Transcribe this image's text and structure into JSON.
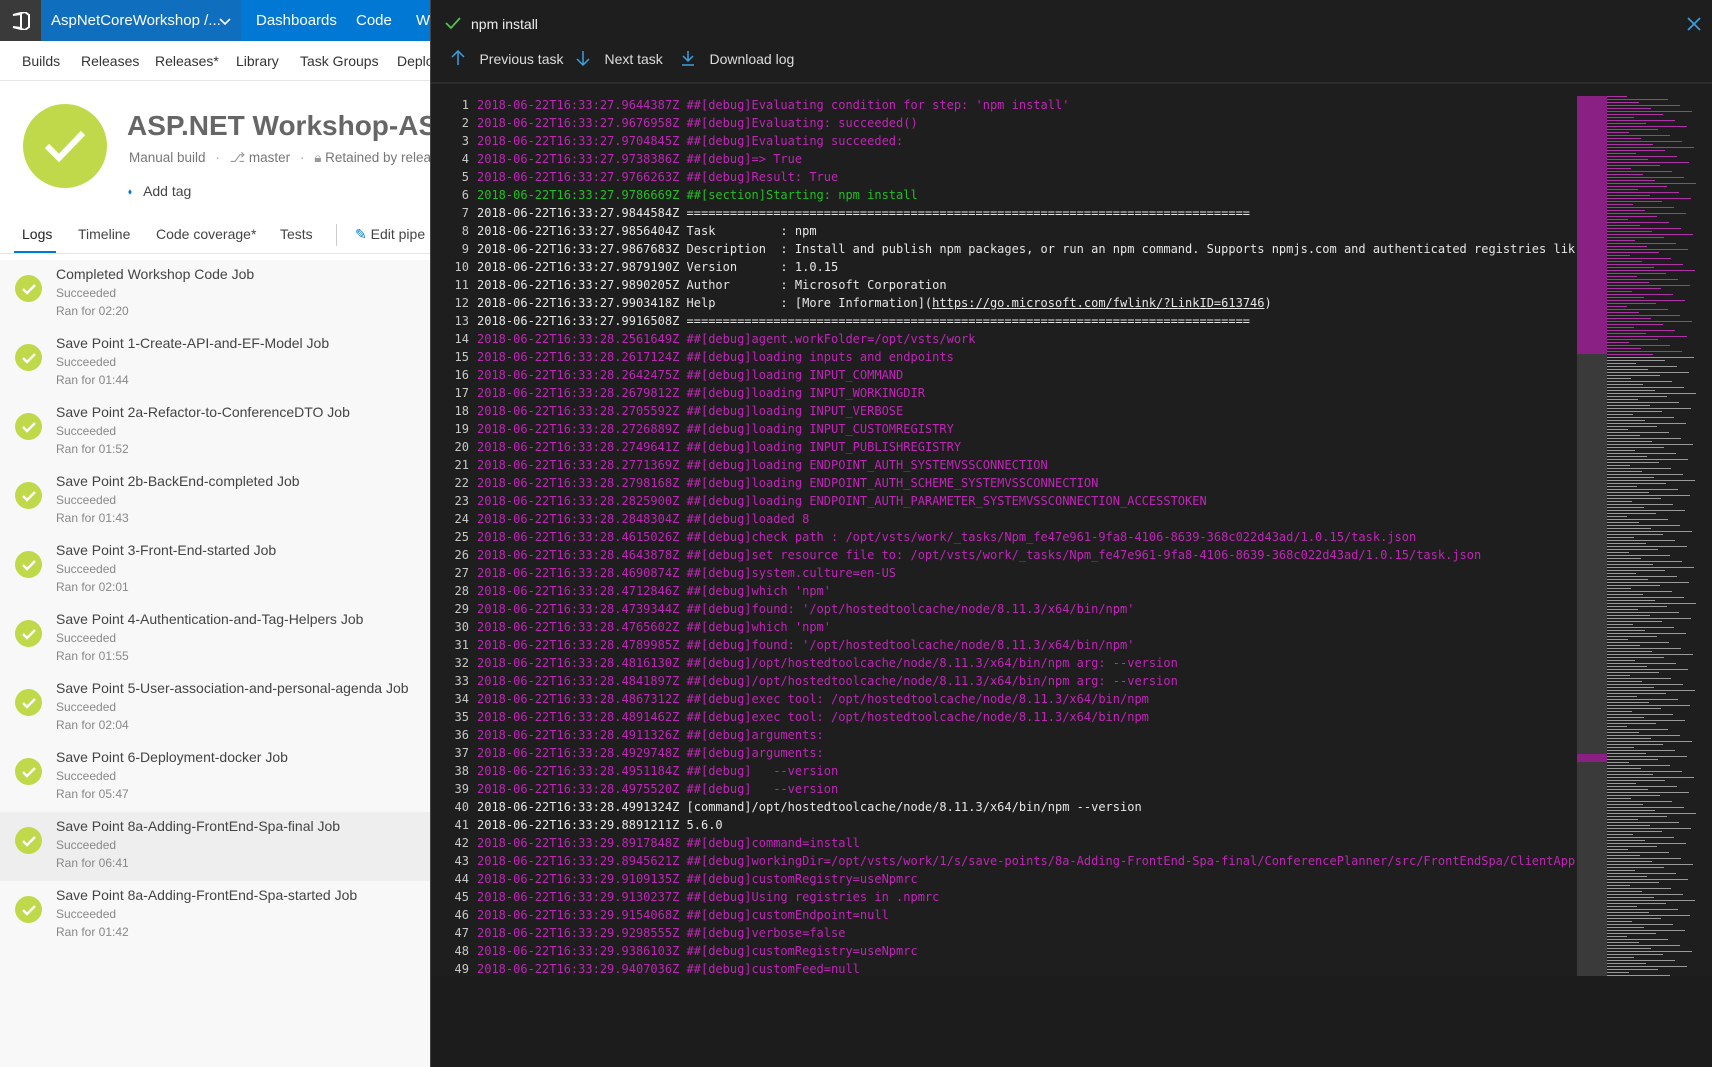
{
  "topbar": {
    "project": "AspNetCoreWorkshop /...",
    "nav": [
      "Dashboards",
      "Code",
      "W"
    ]
  },
  "subnav": [
    "Builds",
    "Releases",
    "Releases*",
    "Library",
    "Task Groups",
    "Deplo"
  ],
  "build": {
    "title": "ASP.NET Workshop-ASP",
    "trigger": "Manual build",
    "branch": "master",
    "retained": "Retained by relea",
    "add_tag": "Add tag"
  },
  "tabs": [
    "Logs",
    "Timeline",
    "Code coverage*",
    "Tests",
    "Edit pipe"
  ],
  "jobs": [
    {
      "name": "Completed Workshop Code Job",
      "status": "Succeeded",
      "duration": "Ran for 02:20"
    },
    {
      "name": "Save Point 1-Create-API-and-EF-Model Job",
      "status": "Succeeded",
      "duration": "Ran for 01:44"
    },
    {
      "name": "Save Point 2a-Refactor-to-ConferenceDTO Job",
      "status": "Succeeded",
      "duration": "Ran for 01:52"
    },
    {
      "name": "Save Point 2b-BackEnd-completed Job",
      "status": "Succeeded",
      "duration": "Ran for 01:43"
    },
    {
      "name": "Save Point 3-Front-End-started Job",
      "status": "Succeeded",
      "duration": "Ran for 02:01"
    },
    {
      "name": "Save Point 4-Authentication-and-Tag-Helpers Job",
      "status": "Succeeded",
      "duration": "Ran for 01:55"
    },
    {
      "name": "Save Point 5-User-association-and-personal-agenda Job",
      "status": "Succeeded",
      "duration": "Ran for 02:04"
    },
    {
      "name": "Save Point 6-Deployment-docker Job",
      "status": "Succeeded",
      "duration": "Ran for 05:47"
    },
    {
      "name": "Save Point 8a-Adding-FrontEnd-Spa-final Job",
      "status": "Succeeded",
      "duration": "Ran for 06:41"
    },
    {
      "name": "Save Point 8a-Adding-FrontEnd-Spa-started Job",
      "status": "Succeeded",
      "duration": "Ran for 01:42"
    }
  ],
  "panel": {
    "task_title": "npm install",
    "toolbar": {
      "previous": "Previous task",
      "next": "Next task",
      "download": "Download log"
    }
  },
  "colors": {
    "success": "#bfd94b",
    "accent": "#0078d4",
    "debug": "#c024b8",
    "section": "#20c020"
  },
  "log": [
    {
      "n": "1",
      "kind": "debug",
      "text": "2018-06-22T16:33:27.9644387Z ##[debug]Evaluating condition for step: 'npm install'"
    },
    {
      "n": "2",
      "kind": "debug",
      "text": "2018-06-22T16:33:27.9676958Z ##[debug]Evaluating: succeeded()"
    },
    {
      "n": "3",
      "kind": "debug",
      "text": "2018-06-22T16:33:27.9704845Z ##[debug]Evaluating succeeded:"
    },
    {
      "n": "4",
      "kind": "debug",
      "text": "2018-06-22T16:33:27.9738386Z ##[debug]=> True"
    },
    {
      "n": "5",
      "kind": "debug",
      "text": "2018-06-22T16:33:27.9766263Z ##[debug]Result: True"
    },
    {
      "n": "6",
      "kind": "section",
      "text": "2018-06-22T16:33:27.9786669Z ##[section]Starting: npm install"
    },
    {
      "n": "7",
      "kind": "plain",
      "text": "2018-06-22T16:33:27.9844584Z =============================================================================="
    },
    {
      "n": "8",
      "kind": "plain",
      "text": "2018-06-22T16:33:27.9856404Z Task         : npm"
    },
    {
      "n": "9",
      "kind": "plain",
      "text": "2018-06-22T16:33:27.9867683Z Description  : Install and publish npm packages, or run an npm command. Supports npmjs.com and authenticated registries lik"
    },
    {
      "n": "10",
      "kind": "plain",
      "text": "2018-06-22T16:33:27.9879190Z Version      : 1.0.15"
    },
    {
      "n": "11",
      "kind": "plain",
      "text": "2018-06-22T16:33:27.9890205Z Author       : Microsoft Corporation"
    },
    {
      "n": "12",
      "kind": "plain",
      "text": "2018-06-22T16:33:27.9903418Z Help         : [More Information](",
      "link": "https://go.microsoft.com/fwlink/?LinkID=613746",
      "after": ")"
    },
    {
      "n": "13",
      "kind": "plain",
      "text": "2018-06-22T16:33:27.9916508Z =============================================================================="
    },
    {
      "n": "14",
      "kind": "debug",
      "text": "2018-06-22T16:33:28.2561649Z ##[debug]agent.workFolder=/opt/vsts/work"
    },
    {
      "n": "15",
      "kind": "debug",
      "text": "2018-06-22T16:33:28.2617124Z ##[debug]loading inputs and endpoints"
    },
    {
      "n": "16",
      "kind": "debug",
      "text": "2018-06-22T16:33:28.2642475Z ##[debug]loading INPUT_COMMAND"
    },
    {
      "n": "17",
      "kind": "debug",
      "text": "2018-06-22T16:33:28.2679812Z ##[debug]loading INPUT_WORKINGDIR"
    },
    {
      "n": "18",
      "kind": "debug",
      "text": "2018-06-22T16:33:28.2705592Z ##[debug]loading INPUT_VERBOSE"
    },
    {
      "n": "19",
      "kind": "debug",
      "text": "2018-06-22T16:33:28.2726889Z ##[debug]loading INPUT_CUSTOMREGISTRY"
    },
    {
      "n": "20",
      "kind": "debug",
      "text": "2018-06-22T16:33:28.2749641Z ##[debug]loading INPUT_PUBLISHREGISTRY"
    },
    {
      "n": "21",
      "kind": "debug",
      "text": "2018-06-22T16:33:28.2771369Z ##[debug]loading ENDPOINT_AUTH_SYSTEMVSSCONNECTION"
    },
    {
      "n": "22",
      "kind": "debug",
      "text": "2018-06-22T16:33:28.2798168Z ##[debug]loading ENDPOINT_AUTH_SCHEME_SYSTEMVSSCONNECTION"
    },
    {
      "n": "23",
      "kind": "debug",
      "text": "2018-06-22T16:33:28.2825900Z ##[debug]loading ENDPOINT_AUTH_PARAMETER_SYSTEMVSSCONNECTION_ACCESSTOKEN"
    },
    {
      "n": "24",
      "kind": "debug",
      "text": "2018-06-22T16:33:28.2848304Z ##[debug]loaded 8"
    },
    {
      "n": "25",
      "kind": "debug",
      "text": "2018-06-22T16:33:28.4615026Z ##[debug]check path : /opt/vsts/work/_tasks/Npm_fe47e961-9fa8-4106-8639-368c022d43ad/1.0.15/task.json"
    },
    {
      "n": "26",
      "kind": "debug",
      "text": "2018-06-22T16:33:28.4643878Z ##[debug]set resource file to: /opt/vsts/work/_tasks/Npm_fe47e961-9fa8-4106-8639-368c022d43ad/1.0.15/task.json"
    },
    {
      "n": "27",
      "kind": "debug",
      "text": "2018-06-22T16:33:28.4690874Z ##[debug]system.culture=en-US"
    },
    {
      "n": "28",
      "kind": "debug",
      "text": "2018-06-22T16:33:28.4712846Z ##[debug]which 'npm'"
    },
    {
      "n": "29",
      "kind": "debug",
      "text": "2018-06-22T16:33:28.4739344Z ##[debug]found: '/opt/hostedtoolcache/node/8.11.3/x64/bin/npm'"
    },
    {
      "n": "30",
      "kind": "debug",
      "text": "2018-06-22T16:33:28.4765602Z ##[debug]which 'npm'"
    },
    {
      "n": "31",
      "kind": "debug",
      "text": "2018-06-22T16:33:28.4789985Z ##[debug]found: '/opt/hostedtoolcache/node/8.11.3/x64/bin/npm'"
    },
    {
      "n": "32",
      "kind": "debug",
      "text": "2018-06-22T16:33:28.4816130Z ##[debug]/opt/hostedtoolcache/node/8.11.3/x64/bin/npm arg: --version"
    },
    {
      "n": "33",
      "kind": "debug",
      "text": "2018-06-22T16:33:28.4841897Z ##[debug]/opt/hostedtoolcache/node/8.11.3/x64/bin/npm arg: --version"
    },
    {
      "n": "34",
      "kind": "debug",
      "text": "2018-06-22T16:33:28.4867312Z ##[debug]exec tool: /opt/hostedtoolcache/node/8.11.3/x64/bin/npm"
    },
    {
      "n": "35",
      "kind": "debug",
      "text": "2018-06-22T16:33:28.4891462Z ##[debug]exec tool: /opt/hostedtoolcache/node/8.11.3/x64/bin/npm"
    },
    {
      "n": "36",
      "kind": "debug",
      "text": "2018-06-22T16:33:28.4911326Z ##[debug]arguments:"
    },
    {
      "n": "37",
      "kind": "debug",
      "text": "2018-06-22T16:33:28.4929748Z ##[debug]arguments:"
    },
    {
      "n": "38",
      "kind": "debug",
      "text": "2018-06-22T16:33:28.4951184Z ##[debug]   --version"
    },
    {
      "n": "39",
      "kind": "debug",
      "text": "2018-06-22T16:33:28.4975520Z ##[debug]   --version"
    },
    {
      "n": "40",
      "kind": "plain",
      "text": "2018-06-22T16:33:28.4991324Z [command]/opt/hostedtoolcache/node/8.11.3/x64/bin/npm --version"
    },
    {
      "n": "41",
      "kind": "plain",
      "text": "2018-06-22T16:33:29.8891211Z 5.6.0"
    },
    {
      "n": "42",
      "kind": "debug",
      "text": "2018-06-22T16:33:29.8917848Z ##[debug]command=install"
    },
    {
      "n": "43",
      "kind": "debug",
      "text": "2018-06-22T16:33:29.8945621Z ##[debug]workingDir=/opt/vsts/work/1/s/save-points/8a-Adding-FrontEnd-Spa-final/ConferencePlanner/src/FrontEndSpa/ClientApp"
    },
    {
      "n": "44",
      "kind": "debug",
      "text": "2018-06-22T16:33:29.9109135Z ##[debug]customRegistry=useNpmrc"
    },
    {
      "n": "45",
      "kind": "debug",
      "text": "2018-06-22T16:33:29.9130237Z ##[debug]Using registries in .npmrc"
    },
    {
      "n": "46",
      "kind": "debug",
      "text": "2018-06-22T16:33:29.9154068Z ##[debug]customEndpoint=null"
    },
    {
      "n": "47",
      "kind": "debug",
      "text": "2018-06-22T16:33:29.9298555Z ##[debug]verbose=false"
    },
    {
      "n": "48",
      "kind": "debug",
      "text": "2018-06-22T16:33:29.9386103Z ##[debug]customRegistry=useNpmrc"
    },
    {
      "n": "49",
      "kind": "debug",
      "text": "2018-06-22T16:33:29.9407036Z ##[debug]customFeed=null"
    }
  ]
}
